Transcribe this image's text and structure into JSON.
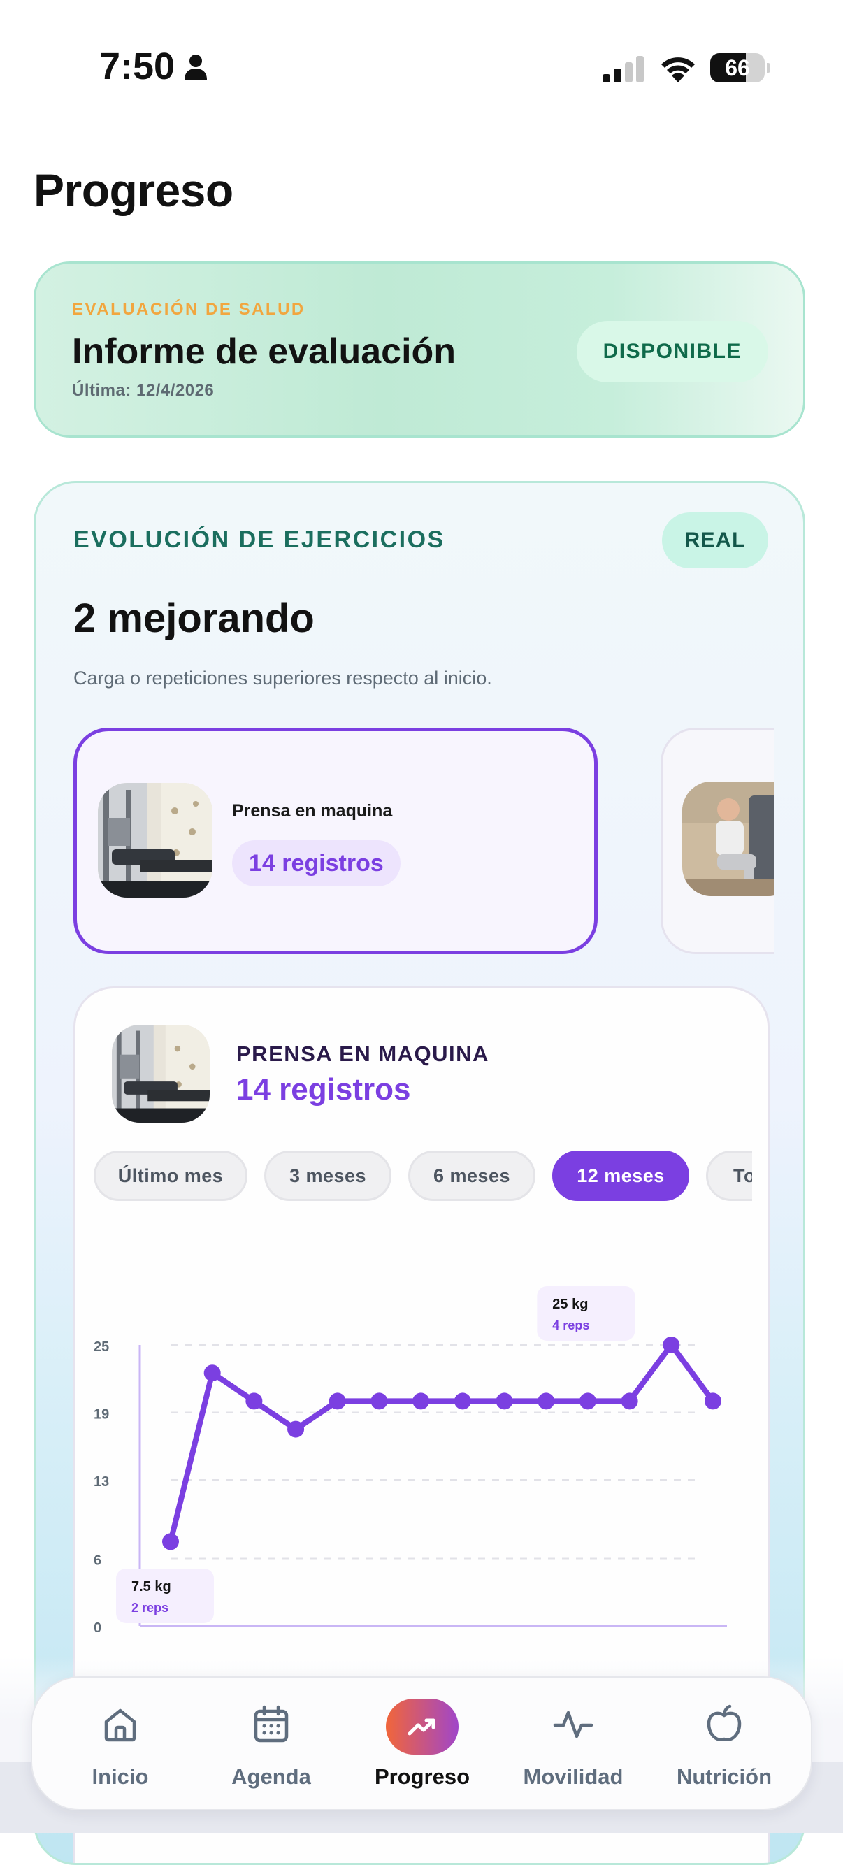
{
  "status": {
    "time": "7:50",
    "battery": "66",
    "battery_level": 66
  },
  "page": {
    "title": "Progreso"
  },
  "evaluation": {
    "kicker": "EVALUACIÓN DE SALUD",
    "title": "Informe de evaluación",
    "last": "Última: 12/4/2026",
    "badge": "DISPONIBLE"
  },
  "evolution": {
    "kicker": "EVOLUCIÓN DE EJERCICIOS",
    "badge": "REAL",
    "count": "2 mejorando",
    "description": "Carga o repeticiones superiores respecto al inicio.",
    "exercises": [
      {
        "name": "Prensa en maquina",
        "records": "14 registros"
      }
    ]
  },
  "detail": {
    "name": "PRENSA EN MAQUINA",
    "records": "14 registros",
    "ranges": [
      "Último mes",
      "3 meses",
      "6 meses",
      "12 meses",
      "To"
    ],
    "active_range": "12 meses"
  },
  "chart_data": {
    "type": "line",
    "y_ticks": [
      "25",
      "19",
      "13",
      "6",
      "0"
    ],
    "ylim": [
      0,
      25
    ],
    "series": [
      {
        "values": [
          7.5,
          22.5,
          20,
          17.5,
          20,
          20,
          20,
          20,
          20,
          20,
          20,
          20,
          25,
          20
        ]
      }
    ],
    "max_label": {
      "kg": "25 kg",
      "reps": "4 reps"
    },
    "min_label": {
      "kg": "7.5 kg",
      "reps": "2 reps"
    },
    "color": "#7b3fe1"
  },
  "nav": {
    "items": [
      {
        "label": "Inicio",
        "icon": "home-icon"
      },
      {
        "label": "Agenda",
        "icon": "calendar-icon"
      },
      {
        "label": "Progreso",
        "icon": "trending-up-icon"
      },
      {
        "label": "Movilidad",
        "icon": "activity-icon"
      },
      {
        "label": "Nutrición",
        "icon": "apple-icon"
      }
    ],
    "active": "Progreso"
  }
}
